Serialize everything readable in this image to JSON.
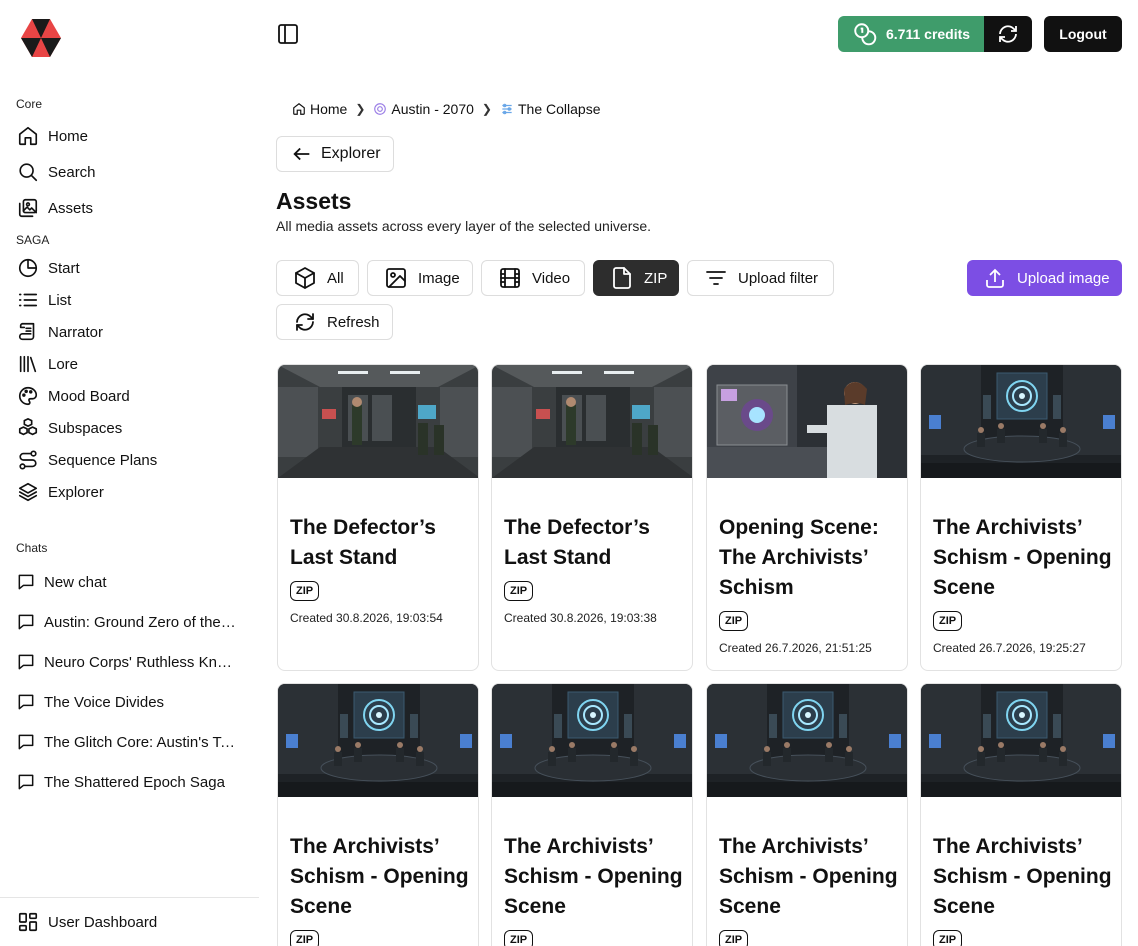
{
  "sidebar": {
    "core_title": "Core",
    "core_items": [
      {
        "label": "Home",
        "icon": "home-icon"
      },
      {
        "label": "Search",
        "icon": "search-icon"
      },
      {
        "label": "Assets",
        "icon": "image-stack-icon"
      }
    ],
    "saga_title": "SAGA",
    "saga_items": [
      {
        "label": "Start",
        "icon": "clock-icon"
      },
      {
        "label": "List",
        "icon": "list-icon"
      },
      {
        "label": "Narrator",
        "icon": "scroll-icon"
      },
      {
        "label": "Lore",
        "icon": "library-icon"
      },
      {
        "label": "Mood Board",
        "icon": "palette-icon"
      },
      {
        "label": "Subspaces",
        "icon": "boxes-icon"
      },
      {
        "label": "Sequence Plans",
        "icon": "route-icon"
      },
      {
        "label": "Explorer",
        "icon": "layers-icon"
      }
    ],
    "chats_title": "Chats",
    "chats": [
      {
        "label": "New chat"
      },
      {
        "label": "Austin: Ground Zero of the Neuro Corps"
      },
      {
        "label": "Neuro Corps' Ruthless Knowledge"
      },
      {
        "label": "The Voice Divides"
      },
      {
        "label": "The Glitch Core: Austin's Test"
      },
      {
        "label": "The Shattered Epoch Saga"
      }
    ],
    "footer": {
      "label": "User Dashboard",
      "icon": "dashboard-icon"
    }
  },
  "topbar": {
    "credits_label": "6.711 credits",
    "logout_label": "Logout",
    "accent_green": "#3f9c6b"
  },
  "breadcrumb": [
    {
      "label": "Home",
      "icon": "home-icon"
    },
    {
      "label": "Austin - 2070",
      "icon": "universe-icon"
    },
    {
      "label": "The Collapse",
      "icon": "layer-icon"
    }
  ],
  "explorer_button": "Explorer",
  "page": {
    "title": "Assets",
    "subtitle": "All media assets across every layer of the selected universe."
  },
  "filters": [
    {
      "label": "All",
      "icon": "cube-icon",
      "active": false
    },
    {
      "label": "Image",
      "icon": "image-icon",
      "active": false
    },
    {
      "label": "Video",
      "icon": "film-icon",
      "active": false
    },
    {
      "label": "ZIP",
      "icon": "file-icon",
      "active": true
    },
    {
      "label": "Upload filter",
      "icon": "filter-icon",
      "active": false
    },
    {
      "label": "Refresh",
      "icon": "refresh-icon",
      "active": false
    }
  ],
  "upload_button": "Upload image",
  "accent_purple": "#7c4ee4",
  "cards": [
    {
      "title": "The Defector’s Last Stand",
      "badge": "ZIP",
      "created": "Created 30.8.2026, 19:03:54",
      "scene": "corridor"
    },
    {
      "title": "The Defector’s Last Stand",
      "badge": "ZIP",
      "created": "Created 30.8.2026, 19:03:38",
      "scene": "corridor"
    },
    {
      "title": "Opening Scene: The Archivists’ Schism",
      "badge": "ZIP",
      "created": "Created 26.7.2026, 21:51:25",
      "scene": "lab"
    },
    {
      "title": "The Archivists’ Schism - Opening Scene",
      "badge": "ZIP",
      "created": "Created 26.7.2026, 19:25:27",
      "scene": "meeting"
    },
    {
      "title": "The Archivists’ Schism - Opening Scene",
      "badge": "ZIP",
      "created": "",
      "scene": "meeting"
    },
    {
      "title": "The Archivists’ Schism - Opening Scene",
      "badge": "ZIP",
      "created": "",
      "scene": "meeting"
    },
    {
      "title": "The Archivists’ Schism - Opening Scene",
      "badge": "ZIP",
      "created": "",
      "scene": "meeting"
    },
    {
      "title": "The Archivists’ Schism - Opening Scene",
      "badge": "ZIP",
      "created": "",
      "scene": "meeting"
    }
  ]
}
